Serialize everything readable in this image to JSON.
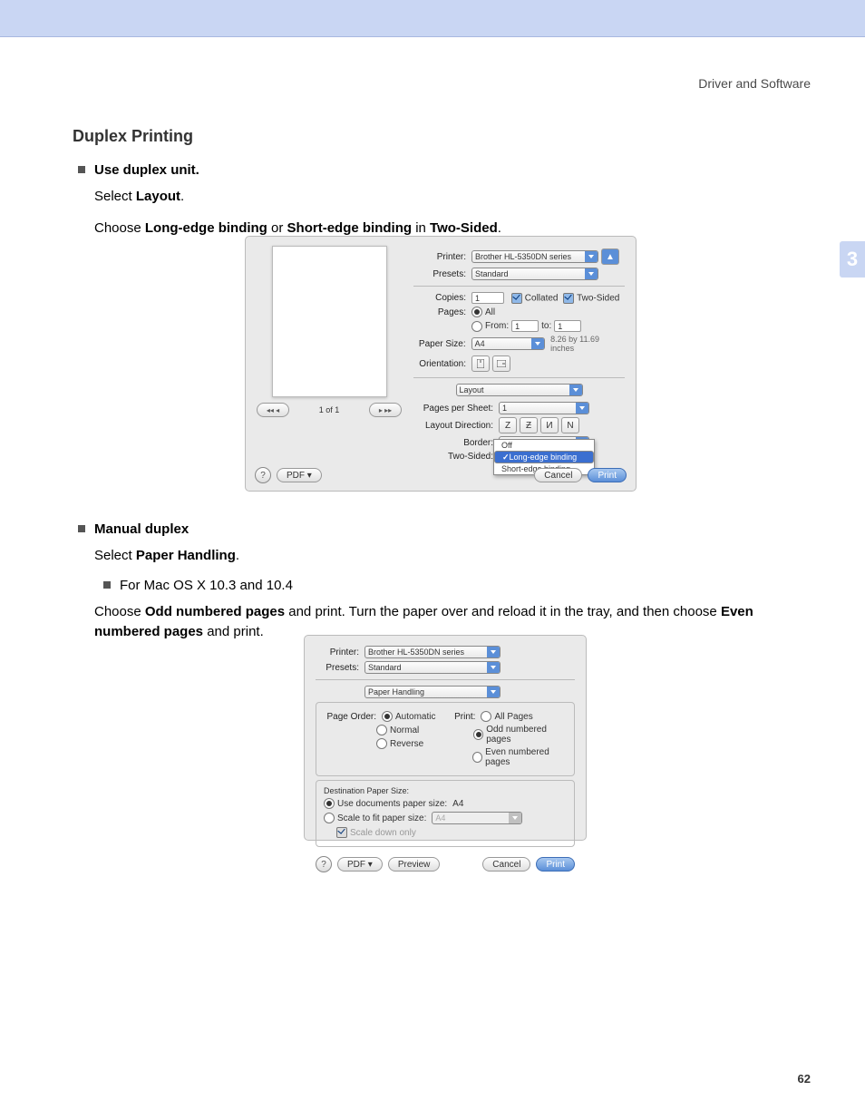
{
  "breadcrumb": "Driver and Software",
  "chapter_number": "3",
  "page_number": "62",
  "heading": "Duplex Printing",
  "section1": {
    "title": "Use duplex unit.",
    "line1_a": "Select ",
    "line1_b": "Layout",
    "line1_c": ".",
    "line2_a": "Choose ",
    "line2_b": "Long-edge binding",
    "line2_c": " or ",
    "line2_d": "Short-edge binding",
    "line2_e": " in ",
    "line2_f": "Two-Sided",
    "line2_g": "."
  },
  "section2": {
    "title": "Manual duplex",
    "line1_a": "Select ",
    "line1_b": "Paper Handling",
    "line1_c": ".",
    "sub_bullet": "For Mac OS X 10.3 and 10.4",
    "line2_a": "Choose ",
    "line2_b": "Odd numbered pages",
    "line2_c": " and print. Turn the paper over and reload it in the tray, and then choose ",
    "line2_d": "Even numbered pages",
    "line2_e": " and print."
  },
  "dlg1": {
    "printer_lbl": "Printer:",
    "printer_val": "Brother HL-5350DN series",
    "presets_lbl": "Presets:",
    "presets_val": "Standard",
    "copies_lbl": "Copies:",
    "copies_val": "1",
    "collated": "Collated",
    "two_sided": "Two-Sided",
    "pages_lbl": "Pages:",
    "all": "All",
    "from": "From:",
    "from_val": "1",
    "to": "to:",
    "to_val": "1",
    "papersize_lbl": "Paper Size:",
    "papersize_val": "A4",
    "papersize_hint": "8.26 by 11.69 inches",
    "orient_lbl": "Orientation:",
    "pane": "Layout",
    "pps_lbl": "Pages per Sheet:",
    "pps_val": "1",
    "layoutdir_lbl": "Layout Direction:",
    "border_lbl": "Border:",
    "twosided_lbl": "Two-Sided:",
    "popup_off": "Off",
    "popup_long": "Long-edge binding",
    "popup_short": "Short-edge binding",
    "nav_count": "1 of 1",
    "pdf": "PDF ▾",
    "cancel": "Cancel",
    "print": "Print"
  },
  "dlg2": {
    "printer_lbl": "Printer:",
    "printer_val": "Brother HL-5350DN series",
    "presets_lbl": "Presets:",
    "presets_val": "Standard",
    "pane": "Paper Handling",
    "pageorder_lbl": "Page Order:",
    "auto": "Automatic",
    "normal": "Normal",
    "reverse": "Reverse",
    "print_lbl": "Print:",
    "allpages": "All Pages",
    "odd": "Odd numbered pages",
    "even": "Even numbered pages",
    "destsize_lbl": "Destination Paper Size:",
    "use_doc": "Use documents paper size:",
    "use_doc_val": "A4",
    "scale": "Scale to fit paper size:",
    "scale_val": "A4",
    "scaledown": "Scale down only",
    "pdf": "PDF ▾",
    "preview": "Preview",
    "cancel": "Cancel",
    "print": "Print"
  }
}
